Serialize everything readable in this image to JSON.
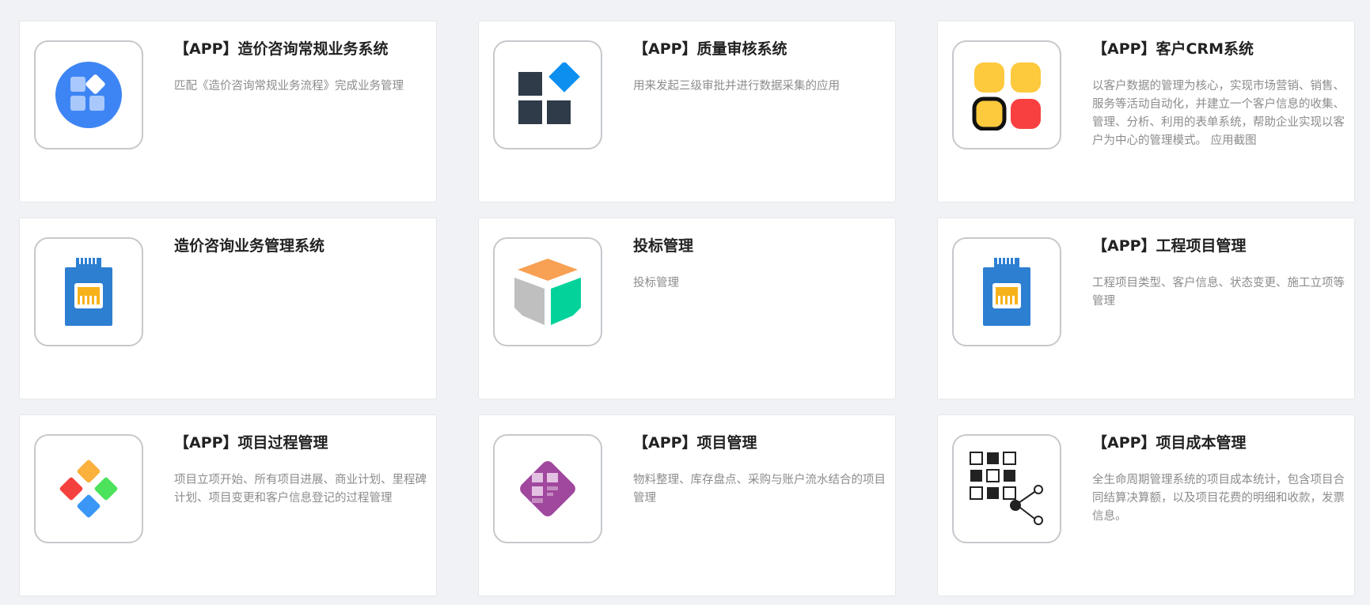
{
  "cards": [
    {
      "title": "【APP】造价咨询常规业务系统",
      "desc": "匹配《造价咨询常规业务流程》完成业务管理",
      "icon": "blue-circle-tiles-icon"
    },
    {
      "title": "【APP】质量审核系统",
      "desc": "用来发起三级审批并进行数据采集的应用",
      "icon": "dark-blocks-diamond-icon"
    },
    {
      "title": "【APP】客户CRM系统",
      "desc": "以客户数据的管理为核心，实现市场营销、销售、服务等活动自动化，并建立一个客户信息的收集、管理、分析、利用的表单系统，帮助企业实现以客户为中心的管理模式。 应用截图",
      "icon": "colored-squares-icon"
    },
    {
      "title": "造价咨询业务管理系统",
      "desc": "",
      "icon": "network-connector-icon"
    },
    {
      "title": "投标管理",
      "desc": "投标管理",
      "icon": "cube-icon"
    },
    {
      "title": "【APP】工程项目管理",
      "desc": "工程项目类型、客户信息、状态变更、施工立项等管理",
      "icon": "network-connector-icon"
    },
    {
      "title": "【APP】项目过程管理",
      "desc": "项目立项开始、所有项目进展、商业计划、里程碑计划、项目变更和客户信息登记的过程管理",
      "icon": "four-diamonds-icon"
    },
    {
      "title": "【APP】项目管理",
      "desc": "物料整理、库存盘点、采购与账户流水结合的项目管理",
      "icon": "purple-diamond-icon"
    },
    {
      "title": "【APP】项目成本管理",
      "desc": "全生命周期管理系统的项目成本统计，包含项目合同结算决算额，以及项目花费的明细和收款，发票信息。",
      "icon": "grid-share-icon"
    }
  ],
  "colors": {
    "background": "#f1f2f5",
    "card": "#ffffff",
    "title": "#222222",
    "desc": "#8c8c8c",
    "blue": "#3d85f4",
    "dark": "#2f3b48",
    "yellow": "#fdc93d",
    "red": "#f94040",
    "orange": "#f8a054",
    "green": "#03d39b",
    "purple": "#a0479e"
  }
}
